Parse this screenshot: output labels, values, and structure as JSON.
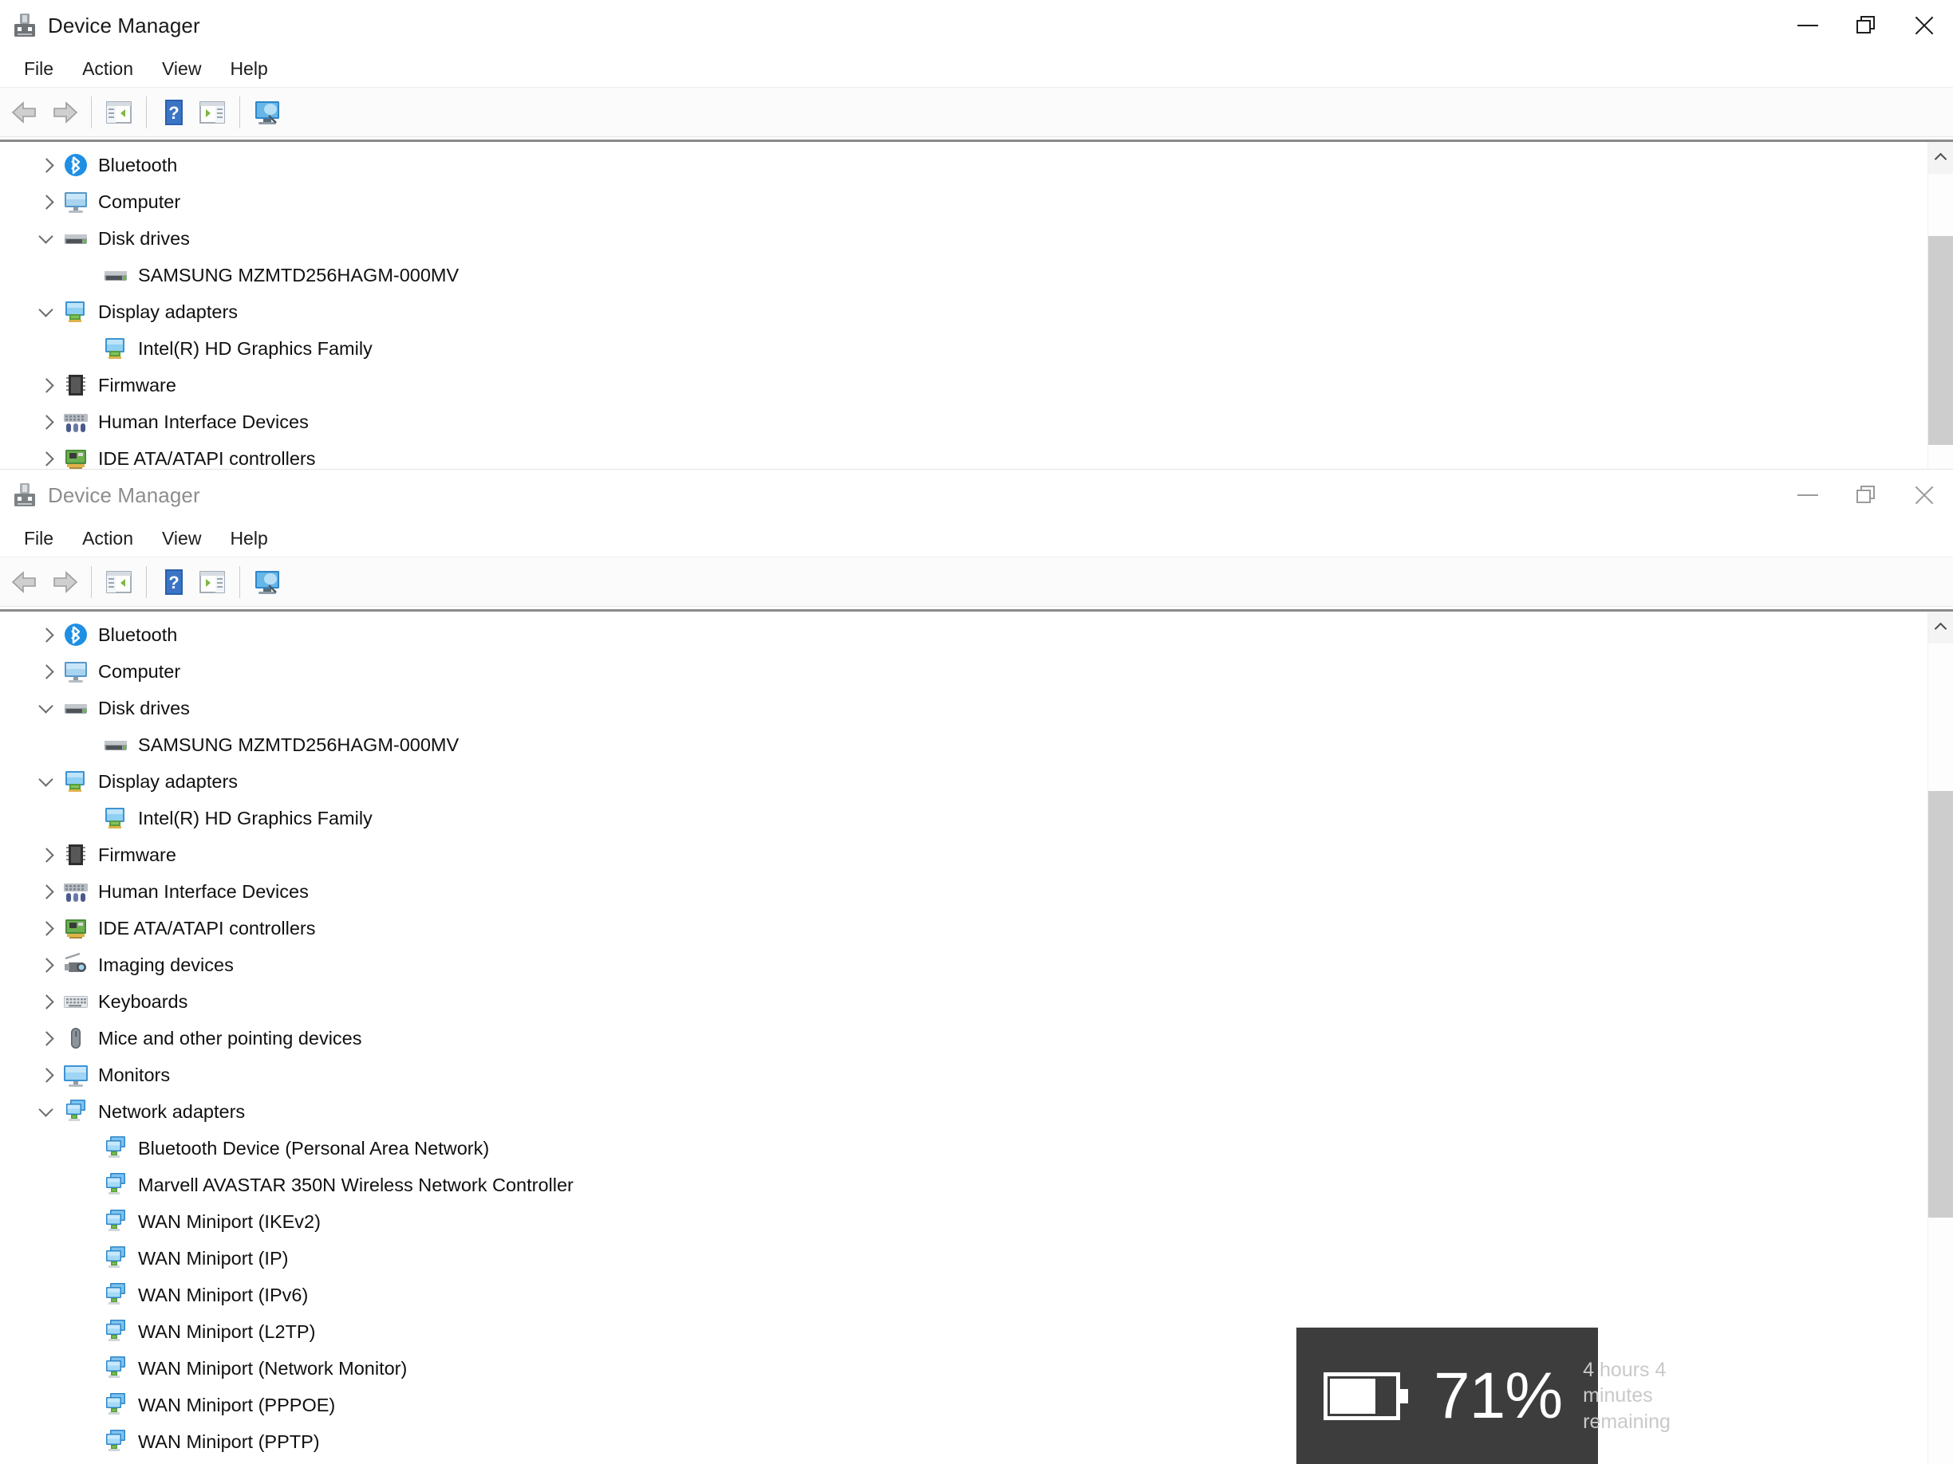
{
  "app": {
    "title": "Device Manager",
    "icon": "device-manager-icon",
    "menu": [
      "File",
      "Action",
      "View",
      "Help"
    ],
    "toolbar": [
      {
        "name": "back-button",
        "icon": "back-arrow-icon"
      },
      {
        "name": "forward-button",
        "icon": "forward-arrow-icon"
      },
      {
        "name": "show-hide-console-tree-button",
        "icon": "console-tree-icon"
      },
      {
        "name": "help-button",
        "icon": "help-question-icon"
      },
      {
        "name": "properties-button",
        "icon": "properties-icon"
      },
      {
        "name": "scan-for-hardware-changes-button",
        "icon": "scan-hardware-icon"
      }
    ],
    "window_controls": {
      "minimize": "minimize-icon",
      "restore": "restore-icon",
      "close": "close-icon"
    }
  },
  "window1": {
    "title": "Device Manager",
    "active": true,
    "tree": [
      {
        "label": "Bluetooth",
        "indent": 1,
        "state": "collapsed",
        "icon": "bluetooth-icon"
      },
      {
        "label": "Computer",
        "indent": 1,
        "state": "collapsed",
        "icon": "computer-icon"
      },
      {
        "label": "Disk drives",
        "indent": 1,
        "state": "expanded",
        "icon": "disk-drive-icon"
      },
      {
        "label": "SAMSUNG MZMTD256HAGM-000MV",
        "indent": 2,
        "state": "leaf",
        "icon": "disk-drive-icon"
      },
      {
        "label": "Display adapters",
        "indent": 1,
        "state": "expanded",
        "icon": "display-adapter-icon"
      },
      {
        "label": "Intel(R) HD Graphics Family",
        "indent": 2,
        "state": "leaf",
        "icon": "display-adapter-icon"
      },
      {
        "label": "Firmware",
        "indent": 1,
        "state": "collapsed",
        "icon": "firmware-icon"
      },
      {
        "label": "Human Interface Devices",
        "indent": 1,
        "state": "collapsed",
        "icon": "hid-icon"
      },
      {
        "label": "IDE ATA/ATAPI controllers",
        "indent": 1,
        "state": "collapsed",
        "icon": "ide-controller-icon"
      }
    ],
    "scrollbar": {
      "thumb_top_pct": 28,
      "thumb_height_pct": 62
    }
  },
  "window2": {
    "title": "Device Manager",
    "active": false,
    "tree": [
      {
        "label": "Bluetooth",
        "indent": 1,
        "state": "collapsed",
        "icon": "bluetooth-icon"
      },
      {
        "label": "Computer",
        "indent": 1,
        "state": "collapsed",
        "icon": "computer-icon"
      },
      {
        "label": "Disk drives",
        "indent": 1,
        "state": "expanded",
        "icon": "disk-drive-icon"
      },
      {
        "label": "SAMSUNG MZMTD256HAGM-000MV",
        "indent": 2,
        "state": "leaf",
        "icon": "disk-drive-icon"
      },
      {
        "label": "Display adapters",
        "indent": 1,
        "state": "expanded",
        "icon": "display-adapter-icon"
      },
      {
        "label": "Intel(R) HD Graphics Family",
        "indent": 2,
        "state": "leaf",
        "icon": "display-adapter-icon"
      },
      {
        "label": "Firmware",
        "indent": 1,
        "state": "collapsed",
        "icon": "firmware-icon"
      },
      {
        "label": "Human Interface Devices",
        "indent": 1,
        "state": "collapsed",
        "icon": "hid-icon"
      },
      {
        "label": "IDE ATA/ATAPI controllers",
        "indent": 1,
        "state": "collapsed",
        "icon": "ide-controller-icon"
      },
      {
        "label": "Imaging devices",
        "indent": 1,
        "state": "collapsed",
        "icon": "imaging-device-icon"
      },
      {
        "label": "Keyboards",
        "indent": 1,
        "state": "collapsed",
        "icon": "keyboard-icon"
      },
      {
        "label": "Mice and other pointing devices",
        "indent": 1,
        "state": "collapsed",
        "icon": "mouse-icon"
      },
      {
        "label": "Monitors",
        "indent": 1,
        "state": "collapsed",
        "icon": "monitor-icon"
      },
      {
        "label": "Network adapters",
        "indent": 1,
        "state": "expanded",
        "icon": "network-adapter-icon"
      },
      {
        "label": "Bluetooth Device (Personal Area Network)",
        "indent": 2,
        "state": "leaf",
        "icon": "network-adapter-icon"
      },
      {
        "label": "Marvell AVASTAR 350N Wireless Network Controller",
        "indent": 2,
        "state": "leaf",
        "icon": "network-adapter-icon"
      },
      {
        "label": "WAN Miniport (IKEv2)",
        "indent": 2,
        "state": "leaf",
        "icon": "network-adapter-icon"
      },
      {
        "label": "WAN Miniport (IP)",
        "indent": 2,
        "state": "leaf",
        "icon": "network-adapter-icon"
      },
      {
        "label": "WAN Miniport (IPv6)",
        "indent": 2,
        "state": "leaf",
        "icon": "network-adapter-icon"
      },
      {
        "label": "WAN Miniport (L2TP)",
        "indent": 2,
        "state": "leaf",
        "icon": "network-adapter-icon"
      },
      {
        "label": "WAN Miniport (Network Monitor)",
        "indent": 2,
        "state": "leaf",
        "icon": "network-adapter-icon"
      },
      {
        "label": "WAN Miniport (PPPOE)",
        "indent": 2,
        "state": "leaf",
        "icon": "network-adapter-icon"
      },
      {
        "label": "WAN Miniport (PPTP)",
        "indent": 2,
        "state": "leaf",
        "icon": "network-adapter-icon"
      }
    ],
    "scrollbar": {
      "thumb_top_pct": 21,
      "thumb_height_pct": 50
    }
  },
  "battery_toast": {
    "percent_label": "71%",
    "percent_value": 71,
    "remaining": "4 hours 4 minutes remaining",
    "icon": "battery-icon",
    "background": "#3d3d3d",
    "percent_color": "#ffffff",
    "sub_color": "#c9c9c9"
  },
  "colors": {
    "window_bg": "#ffffff",
    "toolbar_bg": "#fbfbfb",
    "tree_separator": "#8a8a8a",
    "text": "#101010",
    "inactive_text": "#8d8d8d",
    "bluetooth_blue": "#1f8fe5",
    "scrollbar_thumb": "#cdcdcd"
  }
}
